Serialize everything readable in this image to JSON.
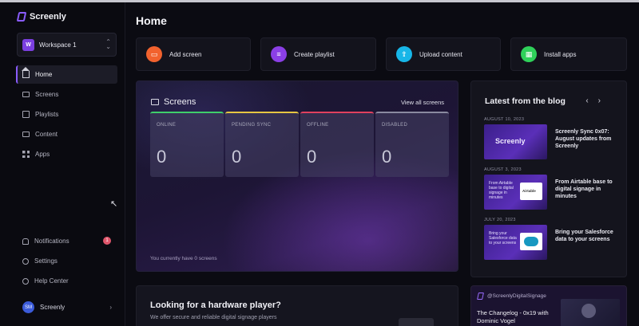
{
  "app": {
    "name": "Screenly"
  },
  "sidebar": {
    "workspace": {
      "avatar": "W",
      "name": "Workspace 1"
    },
    "items": [
      {
        "label": "Home",
        "icon": "home-icon",
        "active": true
      },
      {
        "label": "Screens",
        "icon": "monitor-icon"
      },
      {
        "label": "Playlists",
        "icon": "playlist-icon"
      },
      {
        "label": "Content",
        "icon": "content-icon"
      },
      {
        "label": "Apps",
        "icon": "apps-grid-icon"
      }
    ],
    "bottom": [
      {
        "label": "Notifications",
        "icon": "bell-icon",
        "badge": "1"
      },
      {
        "label": "Settings",
        "icon": "gear-icon"
      },
      {
        "label": "Help Center",
        "icon": "help-icon"
      }
    ],
    "user": {
      "initials": "SM",
      "name": "Screenly"
    }
  },
  "main": {
    "title": "Home",
    "quick_actions": [
      {
        "label": "Add screen",
        "icon": "tv-icon",
        "color": "#f2622e"
      },
      {
        "label": "Create playlist",
        "icon": "playlist-icon",
        "color": "#8b3fe6"
      },
      {
        "label": "Upload content",
        "icon": "upload-icon",
        "color": "#17b6e8"
      },
      {
        "label": "Install apps",
        "icon": "apps-icon",
        "color": "#2fd15a"
      }
    ],
    "screens": {
      "title": "Screens",
      "view_all": "View all screens",
      "stats": [
        {
          "label": "Online",
          "value": "0",
          "color": "#3fcf6b"
        },
        {
          "label": "Pending sync",
          "value": "0",
          "color": "#e6c642"
        },
        {
          "label": "Offline",
          "value": "0",
          "color": "#e0415e"
        },
        {
          "label": "Disabled",
          "value": "0",
          "color": "#8a8aa0"
        }
      ],
      "footer": "You currently have 0 screens"
    },
    "hardware": {
      "title": "Looking for a hardware player?",
      "description": "We offer secure and reliable digital signage players"
    },
    "blog": {
      "title": "Latest from the blog",
      "nav": {
        "prev": "‹",
        "next": "›"
      },
      "posts": [
        {
          "date": "August 10, 2023",
          "title": "Screenly Sync 0x07: August updates from Screenly",
          "thumb_brand": "Screenly"
        },
        {
          "date": "August 3, 2023",
          "title": "From Airtable base to digital signage in minutes",
          "thumb_text": "From Airtable base to digital signage in minutes",
          "thumb_card": "Airtable"
        },
        {
          "date": "July 20, 2023",
          "title": "Bring your Salesforce data to your screens",
          "thumb_text": "Bring your Salesforce data to your screens"
        }
      ]
    },
    "social": {
      "handle": "@ScreenlyDigitalSignage",
      "text": "The Changelog - 0x19 with Dominic Vogel"
    }
  }
}
